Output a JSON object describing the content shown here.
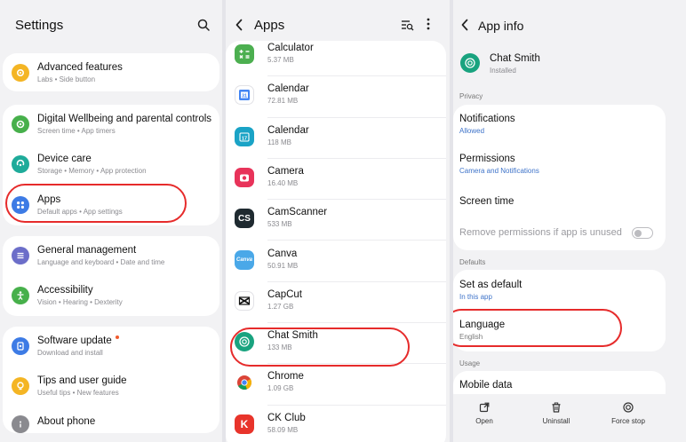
{
  "settings": {
    "title": "Settings",
    "items": [
      {
        "title": "Advanced features",
        "subtitle": "Labs  •  Side button"
      },
      {
        "title": "Digital Wellbeing and parental controls",
        "subtitle": "Screen time  •  App timers"
      },
      {
        "title": "Device care",
        "subtitle": "Storage  •  Memory  •  App protection"
      },
      {
        "title": "Apps",
        "subtitle": "Default apps  •  App settings"
      },
      {
        "title": "General management",
        "subtitle": "Language and keyboard  •  Date and time"
      },
      {
        "title": "Accessibility",
        "subtitle": "Vision  •  Hearing  •  Dexterity"
      },
      {
        "title": "Software update",
        "subtitle": "Download and install"
      },
      {
        "title": "Tips and user guide",
        "subtitle": "Useful tips  •  New features"
      },
      {
        "title": "About phone",
        "subtitle": ""
      }
    ]
  },
  "apps": {
    "title": "Apps",
    "list": [
      {
        "name": "Calculator",
        "size": "5.37 MB",
        "icon_text": "+−×=",
        "color": "#4caf50"
      },
      {
        "name": "Calendar",
        "size": "72.81 MB",
        "icon_text": "31",
        "color": "#ffffff"
      },
      {
        "name": "Calendar",
        "size": "118 MB",
        "icon_text": "17",
        "color": "#1aa3c6"
      },
      {
        "name": "Camera",
        "size": "16.40 MB",
        "icon_text": "",
        "color": "#e8335a"
      },
      {
        "name": "CamScanner",
        "size": "533 MB",
        "icon_text": "CS",
        "color": "#1f2a30"
      },
      {
        "name": "Canva",
        "size": "50.91 MB",
        "icon_text": "Canva",
        "color": "#4aa8e8"
      },
      {
        "name": "CapCut",
        "size": "1.27 GB",
        "icon_text": "",
        "color": "#ffffff"
      },
      {
        "name": "Chat Smith",
        "size": "133 MB",
        "icon_text": "",
        "color": "#19a37f"
      },
      {
        "name": "Chrome",
        "size": "1.09 GB",
        "icon_text": "",
        "color": "#ffffff"
      },
      {
        "name": "CK Club",
        "size": "58.09 MB",
        "icon_text": "K",
        "color": "#e8342b"
      }
    ]
  },
  "appinfo": {
    "title": "App info",
    "app_name": "Chat Smith",
    "app_status": "Installed",
    "privacy_label": "Privacy",
    "notifications": {
      "title": "Notifications",
      "value": "Allowed"
    },
    "permissions": {
      "title": "Permissions",
      "value": "Camera and Notifications"
    },
    "screen_time": "Screen time",
    "remove_permissions": "Remove permissions if app is unused",
    "defaults_label": "Defaults",
    "set_default": {
      "title": "Set as default",
      "value": "In this app"
    },
    "language": {
      "title": "Language",
      "value": "English"
    },
    "usage_label": "Usage",
    "mobile_data": "Mobile data",
    "actions": {
      "open": "Open",
      "uninstall": "Uninstall",
      "force_stop": "Force stop"
    }
  },
  "colors": {
    "highlight": "#e62b2b",
    "link": "#3e73c9"
  }
}
